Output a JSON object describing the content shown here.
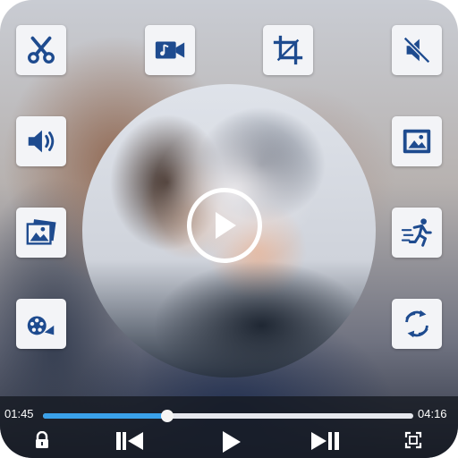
{
  "player": {
    "elapsed": "01:45",
    "duration": "04:16",
    "progress_fraction": 0.335,
    "accent_color": "#3aa1ea",
    "icon_color": "#1e4b8f"
  },
  "tools_left": [
    {
      "icon": "scissors-icon"
    },
    {
      "icon": "volume-icon"
    },
    {
      "icon": "photo-gallery-icon"
    },
    {
      "icon": "film-reel-icon"
    }
  ],
  "tools_top": [
    {
      "icon": "video-music-icon"
    },
    {
      "icon": "crop-icon"
    }
  ],
  "tools_right": [
    {
      "icon": "mute-icon"
    },
    {
      "icon": "image-icon"
    },
    {
      "icon": "fast-motion-icon"
    },
    {
      "icon": "rotate-icon"
    }
  ],
  "controls": [
    "lock-icon",
    "previous-icon",
    "play-icon",
    "next-icon",
    "fullscreen-icon"
  ]
}
